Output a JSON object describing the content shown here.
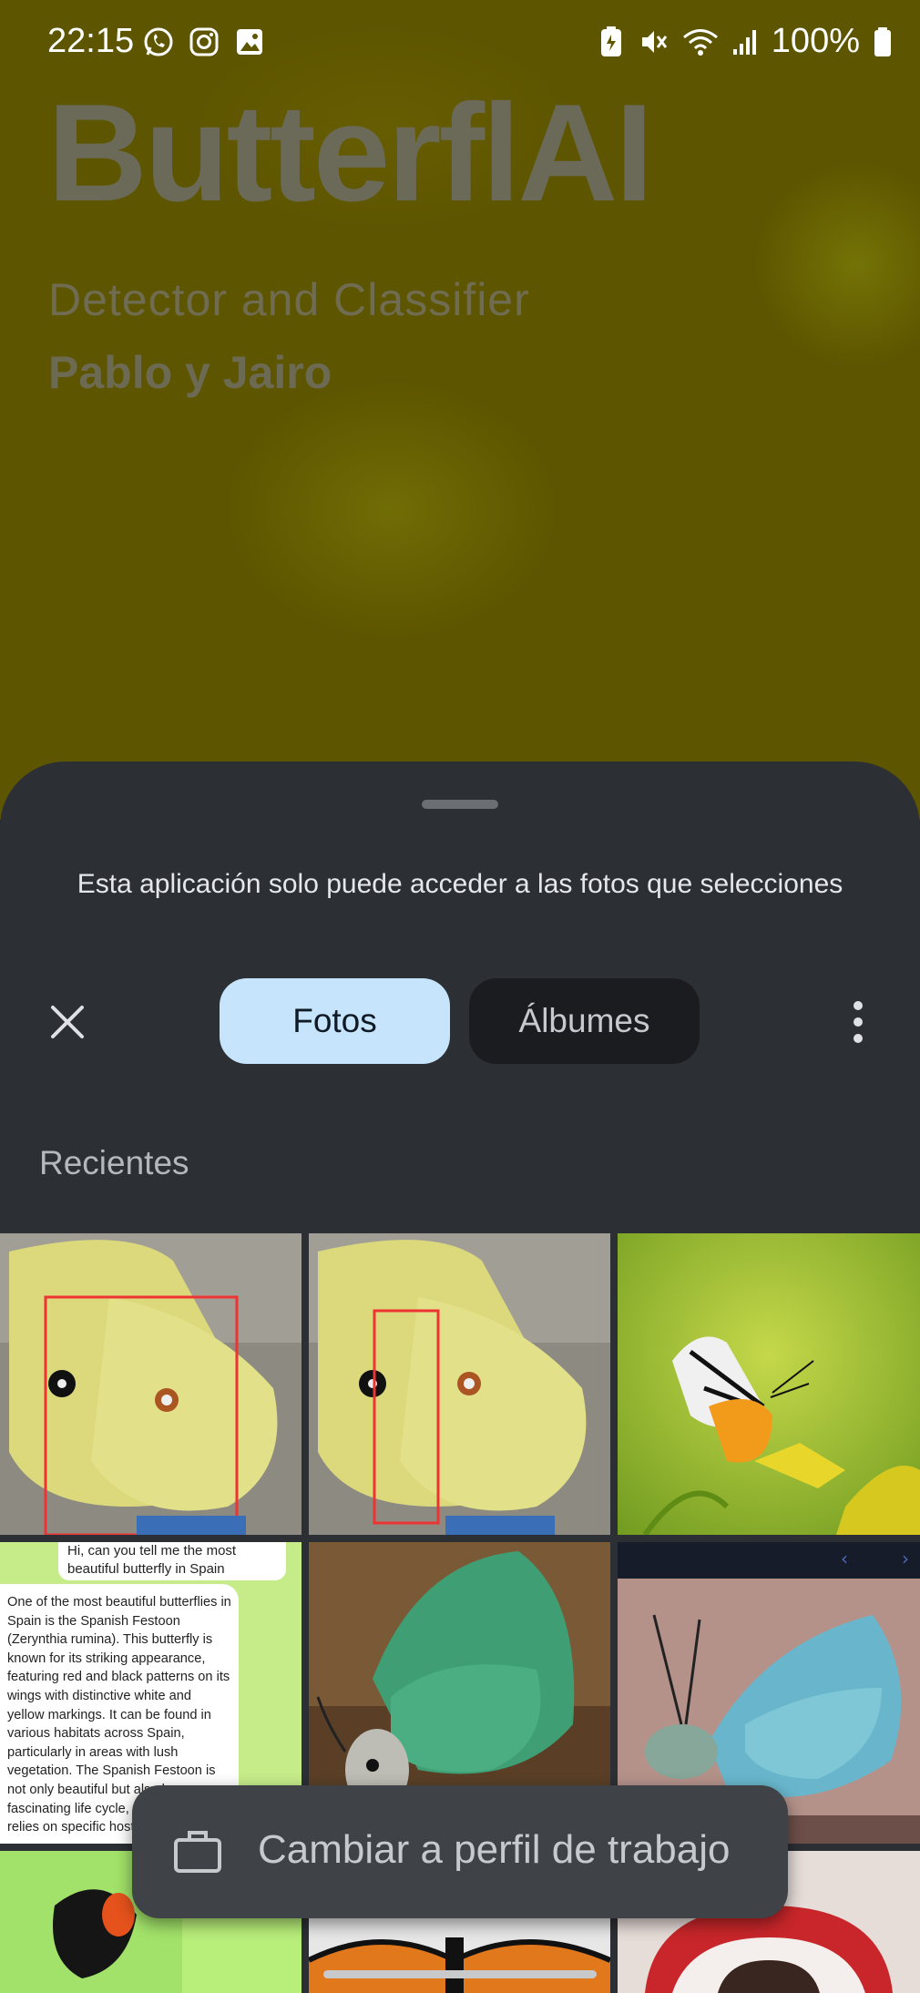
{
  "status_bar": {
    "time": "22:15",
    "battery": "100%",
    "left_icons": [
      "whatsapp-icon",
      "instagram-icon",
      "gallery-icon"
    ],
    "right_icons": [
      "battery-saver-icon",
      "mute-icon",
      "wifi-icon",
      "signal-icon",
      "battery-icon"
    ]
  },
  "app": {
    "title": "ButterflAI",
    "subtitle": "Detector and Classifier",
    "authors": "Pablo y Jairo"
  },
  "picker": {
    "notice": "Esta aplicación solo puede acceder a las fotos que selecciones",
    "tabs": [
      {
        "label": "Fotos",
        "selected": true
      },
      {
        "label": "Álbumes",
        "selected": false
      }
    ],
    "section_label": "Recientes",
    "photos": [
      {
        "name": "clouded-yellow-butterfly-detection-wide"
      },
      {
        "name": "clouded-yellow-butterfly-detection-narrow"
      },
      {
        "name": "butterfly-on-yellow-flower"
      },
      {
        "name": "chat-screenshot"
      },
      {
        "name": "green-hairstreak-butterfly"
      },
      {
        "name": "blue-green-butterfly-closeup"
      },
      {
        "name": "black-orange-butterfly"
      },
      {
        "name": "monarch-butterfly"
      },
      {
        "name": "portrait-with-red-frame"
      }
    ],
    "chat": {
      "question": "Hi, can you tell me the most beautiful butterfly in Spain",
      "answer": "One of the most beautiful butterflies in Spain is the Spanish Festoon (Zerynthia rumina). This butterfly is known for its striking appearance, featuring red and black patterns on its wings with distinctive white and yellow markings. It can be found in various habitats across Spain, particularly in areas with lush vegetation. The Spanish Festoon is not only beautiful but also has a fascinating life cycle, as its larva relies on specific host"
    }
  },
  "work_profile": {
    "label": "Cambiar a perfil de trabajo"
  },
  "colors": {
    "sheet_bg": "#2c2f33",
    "tab_selected_bg": "#c6e4fb",
    "tab_unselected_bg": "#1a1c1f",
    "app_bg": "#5e5500"
  }
}
